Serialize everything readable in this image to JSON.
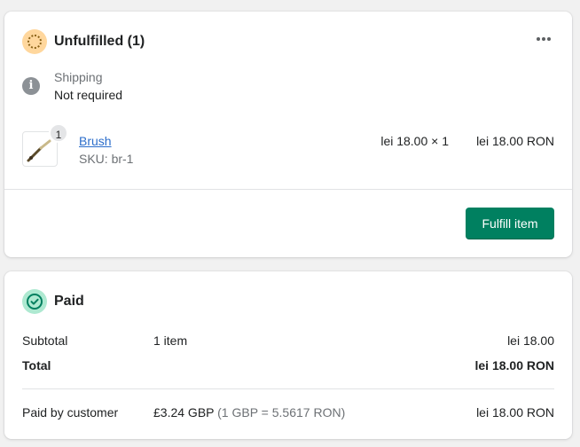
{
  "fulfillment": {
    "title": "Unfulfilled (1)",
    "shipping_label": "Shipping",
    "shipping_value": "Not required",
    "item": {
      "quantity": "1",
      "name": "Brush",
      "sku": "SKU: br-1",
      "unit_price": "lei 18.00 × 1",
      "total": "lei 18.00 RON"
    },
    "fulfill_button": "Fulfill item",
    "status_color": "#ffd79d",
    "icons": {
      "status": "unfulfilled-circle-icon",
      "more": "more-horizontal-icon",
      "info": "info-icon"
    }
  },
  "payment": {
    "title": "Paid",
    "status_color": "#aee9d1",
    "subtotal_label": "Subtotal",
    "subtotal_count": "1 item",
    "subtotal_value": "lei 18.00",
    "total_label": "Total",
    "total_value": "lei 18.00 RON",
    "paid_label": "Paid by customer",
    "paid_amount": "£3.24 GBP",
    "exchange_rate": "(1 GBP = 5.5617 RON)",
    "paid_value": "lei 18.00 RON",
    "icons": {
      "status": "check-circle-icon"
    }
  },
  "colors": {
    "primary_button": "#008060",
    "link": "#2c6ecb"
  }
}
